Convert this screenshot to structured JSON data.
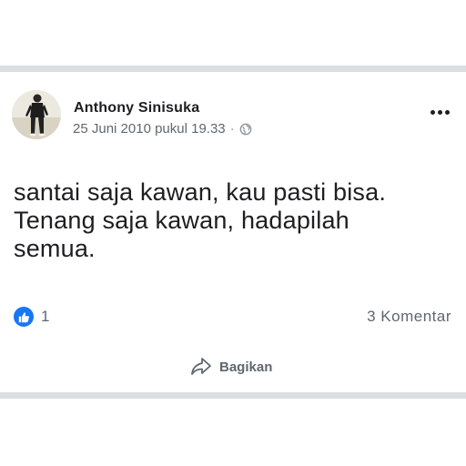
{
  "post": {
    "author": "Anthony Sinisuka",
    "timestamp": "25 Juni 2010 pukul 19.33",
    "separator": "·",
    "privacy_icon": "globe-icon",
    "text_lines": [
      "santai saja kawan, kau pasti bisa.",
      "Tenang saja kawan, hadapilah",
      "semua."
    ],
    "reactions": {
      "icon": "like-icon",
      "count": "1"
    },
    "comments_label": "3 Komentar",
    "share_label": "Bagikan",
    "more_icon": "more-options-icon"
  },
  "colors": {
    "like_blue": "#1877f2",
    "text_primary": "#1c1e21",
    "text_secondary": "#606770",
    "divider": "#dadde1"
  }
}
